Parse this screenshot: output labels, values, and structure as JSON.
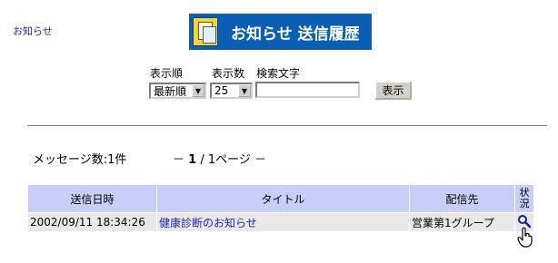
{
  "nav": {
    "link": "お知らせ"
  },
  "banner": {
    "title": "お知らせ 送信履歴",
    "icon": "notice-board-icon"
  },
  "controls": {
    "order_label": "表示順",
    "order_value": "最新順",
    "count_label": "表示数",
    "count_value": "25",
    "search_label": "検索文字",
    "search_value": "",
    "show_button": "表示"
  },
  "summary": {
    "message_count": "メッセージ数:1件",
    "pager_prefix": "－",
    "page_current": "1",
    "page_rest": " / 1ページ －"
  },
  "table": {
    "headers": [
      "送信日時",
      "タイトル",
      "配信先",
      "状況"
    ],
    "rows": [
      {
        "sent_at": "2002/09/11 18:34:26",
        "title": "健康診断のお知らせ",
        "destination": "営業第1グループ",
        "status_icon": "magnifier-icon"
      }
    ]
  },
  "colors": {
    "banner_bg": "#0a5fb4",
    "header_bg": "#c8cef8",
    "row_bg": "#e8e8e8",
    "link": "#2222bb"
  }
}
